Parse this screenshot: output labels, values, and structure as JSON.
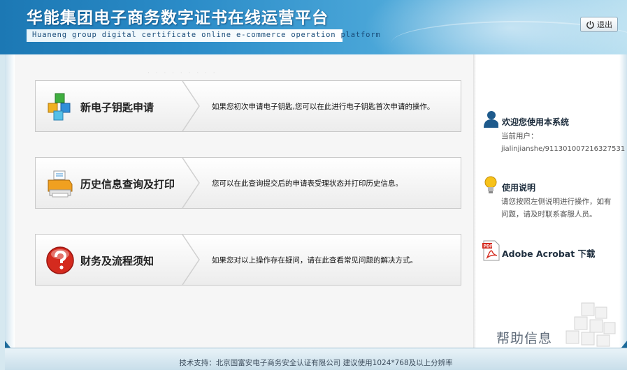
{
  "header": {
    "title": "华能集团电子商务数字证书在线运营平台",
    "subtitle": "Huaneng group digital certificate online e-commerce operation platform",
    "logout_label": "退出"
  },
  "cards": [
    {
      "label": "新电子钥匙申请",
      "description": "如果您初次申请电子钥匙,您可以在此进行电子钥匙首次申请的操作。",
      "icon": "cubes-icon"
    },
    {
      "label": "历史信息查询及打印",
      "description": "您可以在此查询提交后的申请表受理状态并打印历史信息。",
      "icon": "printer-icon"
    },
    {
      "label": "财务及流程须知",
      "description": "如果您对以上操作存在疑问，请在此查看常见问题的解决方式。",
      "icon": "help-icon"
    }
  ],
  "sidebar": {
    "welcome_title": "欢迎您使用本系统",
    "current_user_label": "当前用户：",
    "current_user": "jialinjianshe/911301007216327531",
    "instructions_title": "使用说明",
    "instructions_text": "请您按照左侧说明进行操作，如有问题，请及时联系客服人员。",
    "acrobat_label": "Adobe Acrobat 下载",
    "help_title": "帮助信息"
  },
  "footer": {
    "text": "技术支持：北京国富安电子商务安全认证有限公司 建议使用1024*768及以上分辨率"
  },
  "colors": {
    "header_blue": "#2b8cc8",
    "footer_bg": "#d6e8f0"
  }
}
